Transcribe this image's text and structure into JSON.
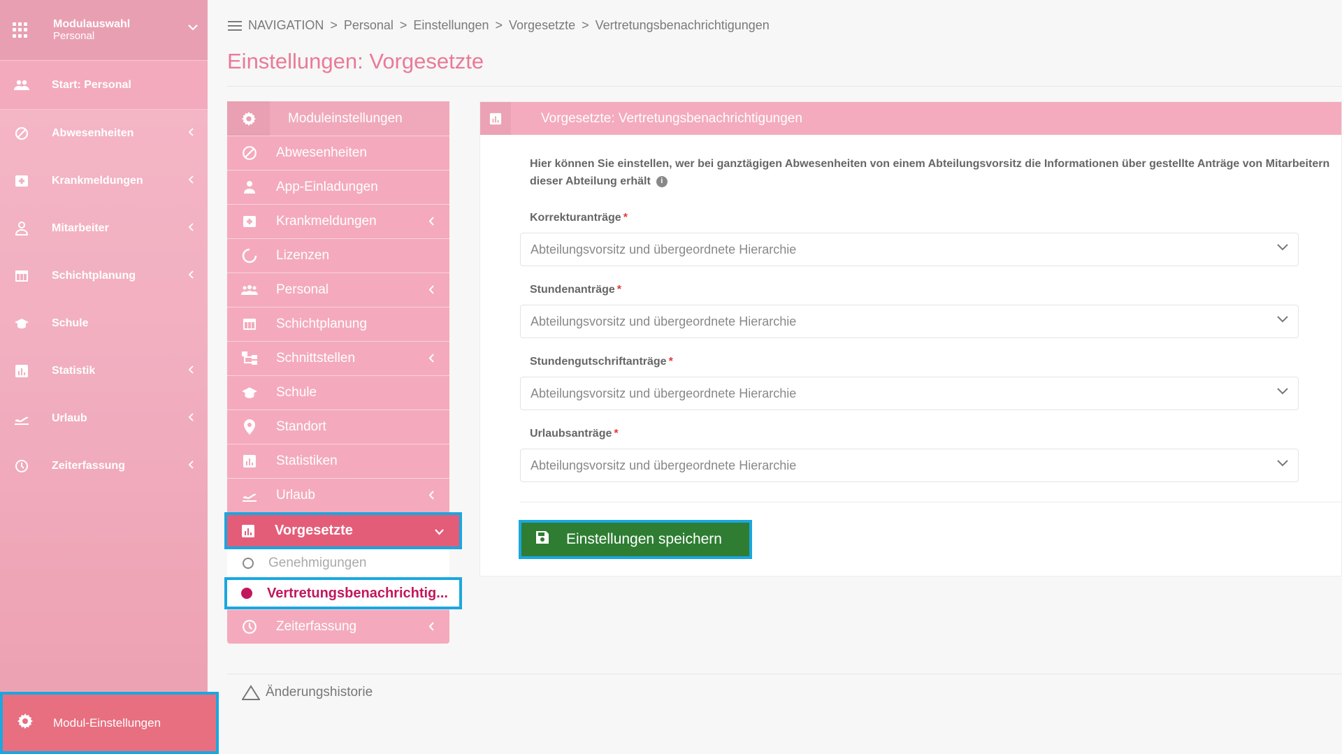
{
  "sidebar": {
    "module_select": {
      "title": "Modulauswahl",
      "subtitle": "Personal"
    },
    "items": [
      {
        "label": "Start: Personal",
        "icon": "people-icon"
      },
      {
        "label": "Abwesenheiten",
        "icon": "absence-icon"
      },
      {
        "label": "Krankmeldungen",
        "icon": "medical-icon"
      },
      {
        "label": "Mitarbeiter",
        "icon": "person-icon"
      },
      {
        "label": "Schichtplanung",
        "icon": "calendar-icon"
      },
      {
        "label": "Schule",
        "icon": "school-icon"
      },
      {
        "label": "Statistik",
        "icon": "chart-icon"
      },
      {
        "label": "Urlaub",
        "icon": "plane-icon"
      },
      {
        "label": "Zeiterfassung",
        "icon": "clock-icon"
      }
    ],
    "settings_label": "Modul-Einstellungen"
  },
  "breadcrumb": [
    "NAVIGATION",
    "Personal",
    "Einstellungen",
    "Vorgesetzte",
    "Vertretungsbenachrichtigungen"
  ],
  "page_title": "Einstellungen: Vorgesetzte",
  "settings_menu": {
    "header": "Moduleinstellungen",
    "items": [
      {
        "label": "Abwesenheiten"
      },
      {
        "label": "App-Einladungen"
      },
      {
        "label": "Krankmeldungen"
      },
      {
        "label": "Lizenzen"
      },
      {
        "label": "Personal"
      },
      {
        "label": "Schichtplanung"
      },
      {
        "label": "Schnittstellen"
      },
      {
        "label": "Schule"
      },
      {
        "label": "Standort"
      },
      {
        "label": "Statistiken"
      },
      {
        "label": "Urlaub"
      }
    ],
    "active_item": "Vorgesetzte",
    "sub_items": [
      {
        "label": "Genehmigungen"
      },
      {
        "label": "Vertretungsbenachrichtig..."
      }
    ],
    "last_item": "Zeiterfassung"
  },
  "panel": {
    "title": "Vorgesetzte: Vertretungsbenachrichtigungen",
    "description": "Hier können Sie einstellen, wer bei ganztägigen Abwesenheiten von einem Abteilungsvorsitz die Informationen über gestellte Anträge von Mitarbeitern dieser Abteilung erhält",
    "fields": [
      {
        "label": "Korrekturanträge",
        "value": "Abteilungsvorsitz und übergeordnete Hierarchie"
      },
      {
        "label": "Stundenanträge",
        "value": "Abteilungsvorsitz und übergeordnete Hierarchie"
      },
      {
        "label": "Stundengutschriftanträge",
        "value": "Abteilungsvorsitz und übergeordnete Hierarchie"
      },
      {
        "label": "Urlaubsanträge",
        "value": "Abteilungsvorsitz und übergeordnete Hierarchie"
      }
    ],
    "required_mark": "*",
    "save_label": "Einstellungen speichern"
  },
  "history_label": "Änderungshistorie",
  "colors": {
    "accent_pink": "#f4abbd",
    "active_pink": "#e45d78",
    "save_green": "#2e7d32",
    "highlight_blue": "#1aa7e0"
  }
}
